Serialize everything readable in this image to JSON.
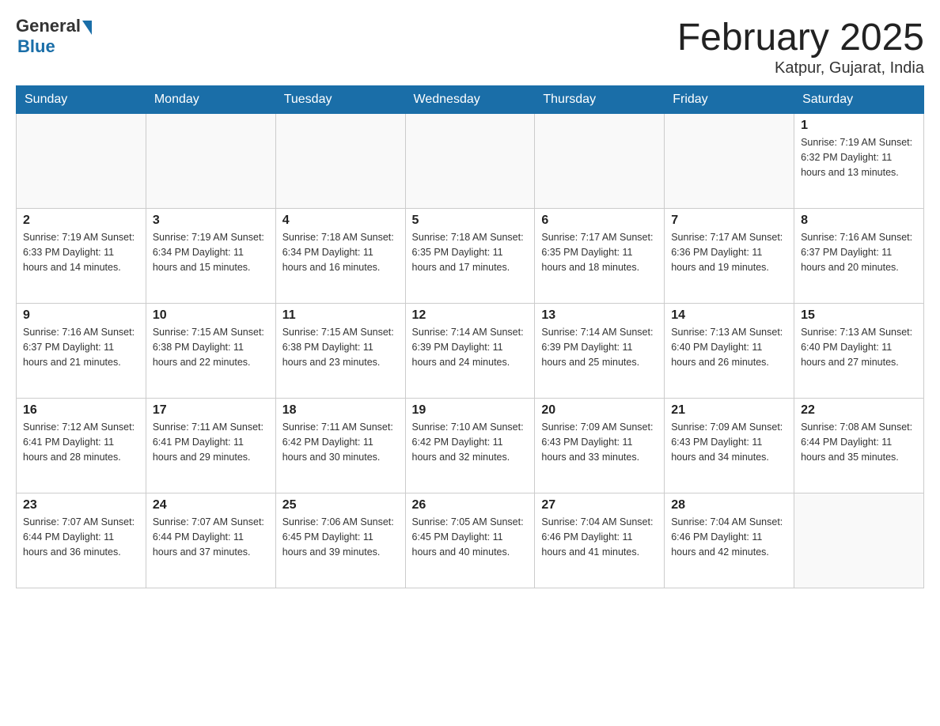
{
  "header": {
    "logo_general": "General",
    "logo_blue": "Blue",
    "month_title": "February 2025",
    "location": "Katpur, Gujarat, India"
  },
  "days_of_week": [
    "Sunday",
    "Monday",
    "Tuesday",
    "Wednesday",
    "Thursday",
    "Friday",
    "Saturday"
  ],
  "weeks": [
    [
      {
        "day": "",
        "info": ""
      },
      {
        "day": "",
        "info": ""
      },
      {
        "day": "",
        "info": ""
      },
      {
        "day": "",
        "info": ""
      },
      {
        "day": "",
        "info": ""
      },
      {
        "day": "",
        "info": ""
      },
      {
        "day": "1",
        "info": "Sunrise: 7:19 AM\nSunset: 6:32 PM\nDaylight: 11 hours and 13 minutes."
      }
    ],
    [
      {
        "day": "2",
        "info": "Sunrise: 7:19 AM\nSunset: 6:33 PM\nDaylight: 11 hours and 14 minutes."
      },
      {
        "day": "3",
        "info": "Sunrise: 7:19 AM\nSunset: 6:34 PM\nDaylight: 11 hours and 15 minutes."
      },
      {
        "day": "4",
        "info": "Sunrise: 7:18 AM\nSunset: 6:34 PM\nDaylight: 11 hours and 16 minutes."
      },
      {
        "day": "5",
        "info": "Sunrise: 7:18 AM\nSunset: 6:35 PM\nDaylight: 11 hours and 17 minutes."
      },
      {
        "day": "6",
        "info": "Sunrise: 7:17 AM\nSunset: 6:35 PM\nDaylight: 11 hours and 18 minutes."
      },
      {
        "day": "7",
        "info": "Sunrise: 7:17 AM\nSunset: 6:36 PM\nDaylight: 11 hours and 19 minutes."
      },
      {
        "day": "8",
        "info": "Sunrise: 7:16 AM\nSunset: 6:37 PM\nDaylight: 11 hours and 20 minutes."
      }
    ],
    [
      {
        "day": "9",
        "info": "Sunrise: 7:16 AM\nSunset: 6:37 PM\nDaylight: 11 hours and 21 minutes."
      },
      {
        "day": "10",
        "info": "Sunrise: 7:15 AM\nSunset: 6:38 PM\nDaylight: 11 hours and 22 minutes."
      },
      {
        "day": "11",
        "info": "Sunrise: 7:15 AM\nSunset: 6:38 PM\nDaylight: 11 hours and 23 minutes."
      },
      {
        "day": "12",
        "info": "Sunrise: 7:14 AM\nSunset: 6:39 PM\nDaylight: 11 hours and 24 minutes."
      },
      {
        "day": "13",
        "info": "Sunrise: 7:14 AM\nSunset: 6:39 PM\nDaylight: 11 hours and 25 minutes."
      },
      {
        "day": "14",
        "info": "Sunrise: 7:13 AM\nSunset: 6:40 PM\nDaylight: 11 hours and 26 minutes."
      },
      {
        "day": "15",
        "info": "Sunrise: 7:13 AM\nSunset: 6:40 PM\nDaylight: 11 hours and 27 minutes."
      }
    ],
    [
      {
        "day": "16",
        "info": "Sunrise: 7:12 AM\nSunset: 6:41 PM\nDaylight: 11 hours and 28 minutes."
      },
      {
        "day": "17",
        "info": "Sunrise: 7:11 AM\nSunset: 6:41 PM\nDaylight: 11 hours and 29 minutes."
      },
      {
        "day": "18",
        "info": "Sunrise: 7:11 AM\nSunset: 6:42 PM\nDaylight: 11 hours and 30 minutes."
      },
      {
        "day": "19",
        "info": "Sunrise: 7:10 AM\nSunset: 6:42 PM\nDaylight: 11 hours and 32 minutes."
      },
      {
        "day": "20",
        "info": "Sunrise: 7:09 AM\nSunset: 6:43 PM\nDaylight: 11 hours and 33 minutes."
      },
      {
        "day": "21",
        "info": "Sunrise: 7:09 AM\nSunset: 6:43 PM\nDaylight: 11 hours and 34 minutes."
      },
      {
        "day": "22",
        "info": "Sunrise: 7:08 AM\nSunset: 6:44 PM\nDaylight: 11 hours and 35 minutes."
      }
    ],
    [
      {
        "day": "23",
        "info": "Sunrise: 7:07 AM\nSunset: 6:44 PM\nDaylight: 11 hours and 36 minutes."
      },
      {
        "day": "24",
        "info": "Sunrise: 7:07 AM\nSunset: 6:44 PM\nDaylight: 11 hours and 37 minutes."
      },
      {
        "day": "25",
        "info": "Sunrise: 7:06 AM\nSunset: 6:45 PM\nDaylight: 11 hours and 39 minutes."
      },
      {
        "day": "26",
        "info": "Sunrise: 7:05 AM\nSunset: 6:45 PM\nDaylight: 11 hours and 40 minutes."
      },
      {
        "day": "27",
        "info": "Sunrise: 7:04 AM\nSunset: 6:46 PM\nDaylight: 11 hours and 41 minutes."
      },
      {
        "day": "28",
        "info": "Sunrise: 7:04 AM\nSunset: 6:46 PM\nDaylight: 11 hours and 42 minutes."
      },
      {
        "day": "",
        "info": ""
      }
    ]
  ]
}
